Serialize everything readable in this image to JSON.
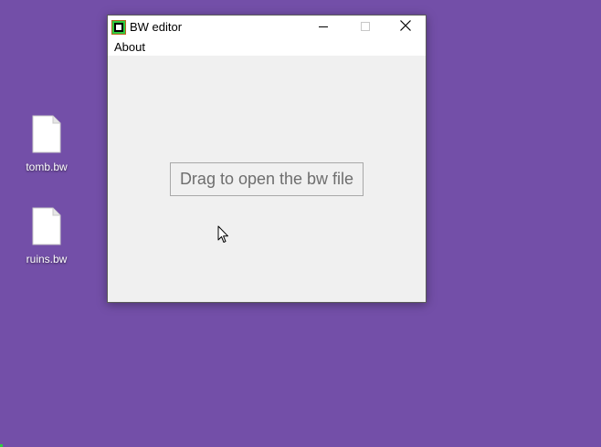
{
  "desktop": {
    "background_color": "#734fa8",
    "icons": [
      {
        "label": "tomb.bw",
        "icon": "file-icon"
      },
      {
        "label": "ruins.bw",
        "icon": "file-icon"
      }
    ]
  },
  "window": {
    "title": "BW editor",
    "app_icon": "bw-editor-app-icon",
    "controls": [
      "minimize-icon",
      "maximize-icon",
      "close-icon"
    ],
    "menu": [
      {
        "label": "About"
      }
    ],
    "drop_zone": {
      "text": "Drag to open the bw file"
    }
  }
}
